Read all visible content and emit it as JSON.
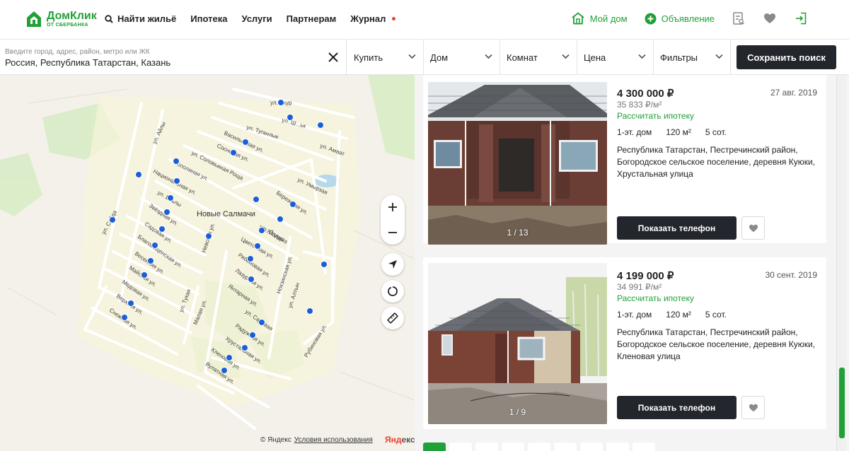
{
  "brand": {
    "name": "ДомКлик",
    "sub": "ОТ СБЕРБАНКА",
    "color": "#21a038"
  },
  "nav": {
    "search": "Найти жильё",
    "mortgage": "Ипотека",
    "services": "Услуги",
    "partners": "Партнерам",
    "journal": "Журнал"
  },
  "header_right": {
    "my_home": "Мой дом",
    "ad": "Объявление"
  },
  "search": {
    "placeholder": "Введите город, адрес, район, метро или ЖК",
    "value": "Россия, Республика Татарстан, Казань"
  },
  "filters": {
    "deal": "Купить",
    "type": "Дом",
    "rooms": "Комнат",
    "price": "Цена",
    "more": "Фильтры",
    "save": "Сохранить поиск"
  },
  "map": {
    "village": "Новые Салмачи",
    "streets": [
      "ул. Ахур",
      "ул. Ш...ьк",
      "ул. Туганлык",
      "Васильковая ул.",
      "Сосновая ул.",
      "ул. Соловьиная Роща",
      "ул. Амаат",
      "ул. Айлы",
      "Тополиная ул.",
      "Национальная ул.",
      "ул. Умырзая",
      "Березовая ул.",
      "ул. Ельлы",
      "Звёздная ул.",
      "ул. Сайда",
      "ул. Юлдыз",
      "Садовая ул.",
      "Благовещенская ул.",
      "Невская ул.",
      "ул. Йолдыз",
      "Цветочная ул.",
      "Весенняя ул.",
      "Рябиновая ул.",
      "Майская ул.",
      "Лазурная ул.",
      "Медовая ул.",
      "Янтарная ул.",
      "Верхняя ул.",
      "Снежная ул.",
      "ул. Тукая",
      "Малая ул.",
      "ул. Садовая",
      "Радужная ул.",
      "Хрустальная ул.",
      "Кленовая ул.",
      "Вулатная ул.",
      "Нокзинская ул.",
      "ул. Алтын",
      "Рубиновая ул."
    ],
    "copyright": "© Яндекс",
    "terms": "Условия использования",
    "yandex_logo_main": "Янд",
    "yandex_logo_red": "екс"
  },
  "listings": [
    {
      "price": "4 300 000 ₽",
      "price_per_m2": "35 833 ₽/м²",
      "mortgage": "Рассчитать ипотеку",
      "date": "27 авг. 2019",
      "floors": "1-эт. дом",
      "area": "120 м²",
      "land": "5 сот.",
      "address": "Республика Татарстан, Пестречинский район, Богородское сельское поселение, деревня Куюки, Хрустальная улица",
      "photos": "1 / 13",
      "phone_btn": "Показать телефон"
    },
    {
      "price": "4 199 000 ₽",
      "price_per_m2": "34 991 ₽/м²",
      "mortgage": "Рассчитать ипотеку",
      "date": "30 сент. 2019",
      "floors": "1-эт. дом",
      "area": "120 м²",
      "land": "5 сот.",
      "address": "Республика Татарстан, Пестречинский район, Богородское сельское поселение, деревня Куюки, Кленовая улица",
      "photos": "1 / 9",
      "phone_btn": "Показать телефон"
    }
  ],
  "icons": {
    "logo": "house-logo-icon",
    "search": "search-icon",
    "home": "home-icon",
    "plus": "plus-circle-icon",
    "compare": "compare-icon",
    "heart": "heart-icon",
    "login": "login-icon",
    "clear": "close-icon",
    "chevron": "chevron-down-icon",
    "zoom_in": "zoom-in-icon",
    "zoom_out": "zoom-out-icon",
    "locate": "geolocation-icon",
    "area": "draw-area-icon",
    "ruler": "ruler-icon"
  }
}
